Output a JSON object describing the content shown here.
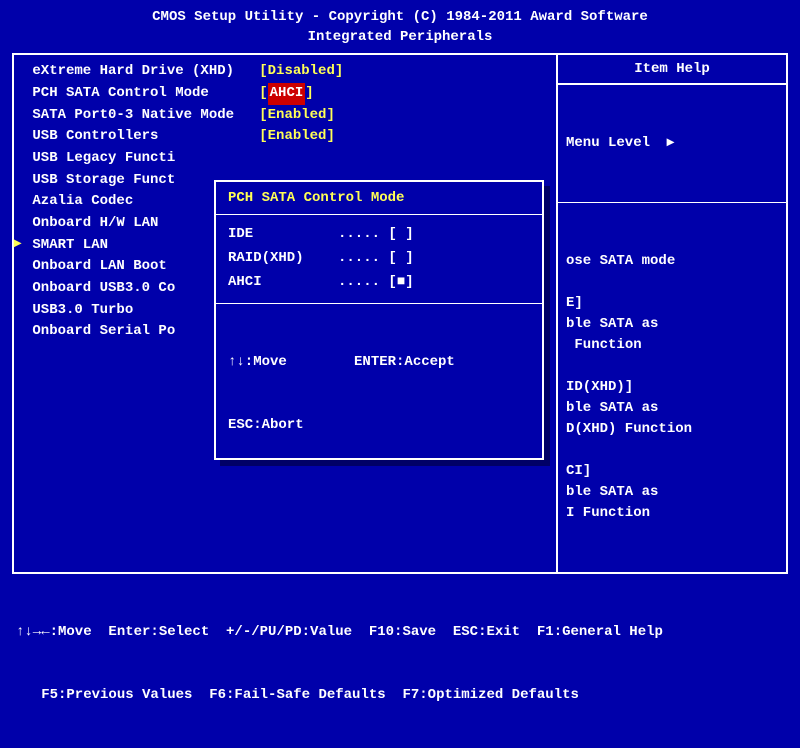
{
  "header": {
    "line1": "CMOS Setup Utility - Copyright (C) 1984-2011 Award Software",
    "line2": "Integrated Peripherals"
  },
  "settings": [
    {
      "label": "eXtreme Hard Drive (XHD)",
      "value": "[Disabled]",
      "selected": false
    },
    {
      "label": "PCH SATA Control Mode",
      "value": "AHCI",
      "selected": true,
      "bracketed": true
    },
    {
      "label": "SATA Port0-3 Native Mode",
      "value": "[Enabled]",
      "selected": false
    },
    {
      "label": "USB Controllers",
      "value": "[Enabled]",
      "selected": false
    },
    {
      "label": "USB Legacy Functi",
      "value": "",
      "selected": false
    },
    {
      "label": "USB Storage Funct",
      "value": "",
      "selected": false
    },
    {
      "label": "Azalia Codec",
      "value": "",
      "selected": false
    },
    {
      "label": "Onboard H/W LAN",
      "value": "",
      "selected": false
    },
    {
      "label": "SMART LAN",
      "value": "",
      "selected": false,
      "pointer": true
    },
    {
      "label": "Onboard LAN Boot",
      "value": "",
      "selected": false
    },
    {
      "label": "Onboard USB3.0 Co",
      "value": "",
      "selected": false
    },
    {
      "label": "USB3.0 Turbo",
      "value": "",
      "selected": false
    },
    {
      "label": "Onboard Serial Po",
      "value": "",
      "selected": false
    }
  ],
  "help": {
    "header": "Item Help",
    "menu_level_label": "Menu Level  ▸",
    "body": "ose SATA mode\n\nE]\nble SATA as\n Function\n\nID(XHD)]\nble SATA as\nD(XHD) Function\n\nCI]\nble SATA as\nI Function"
  },
  "popup": {
    "title": "PCH SATA Control Mode",
    "options": [
      {
        "label": "IDE",
        "dots": ".....",
        "mark": "[ ]"
      },
      {
        "label": "RAID(XHD)",
        "dots": ".....",
        "mark": "[ ]"
      },
      {
        "label": "AHCI",
        "dots": ".....",
        "mark": "[■]"
      }
    ],
    "foot_line1": "↑↓:Move        ENTER:Accept",
    "foot_line2": "ESC:Abort"
  },
  "footer": {
    "line1": "↑↓→←:Move  Enter:Select  +/-/PU/PD:Value  F10:Save  ESC:Exit  F1:General Help",
    "line2": "   F5:Previous Values  F6:Fail-Safe Defaults  F7:Optimized Defaults"
  }
}
